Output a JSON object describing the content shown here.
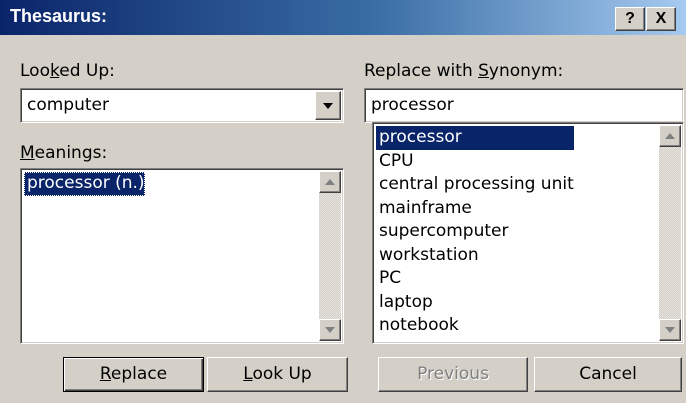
{
  "window": {
    "title": "Thesaurus:",
    "help_button": "?",
    "close_button": "X"
  },
  "looked_up": {
    "label_pre": "Loo",
    "label_key": "k",
    "label_post": "ed Up:",
    "value": "computer"
  },
  "meanings": {
    "label_key": "M",
    "label_post": "eanings:",
    "items": [
      "processor (n.)"
    ]
  },
  "replace_with": {
    "label_pre": "Replace with ",
    "label_key": "S",
    "label_post": "ynonym:",
    "value": "processor"
  },
  "synonyms": {
    "items": [
      "processor",
      "CPU",
      "central processing unit",
      "mainframe",
      "supercomputer",
      "workstation",
      "PC",
      "laptop",
      "notebook"
    ]
  },
  "buttons": {
    "replace_key": "R",
    "replace_post": "eplace",
    "lookup_key": "L",
    "lookup_post": "ook Up",
    "previous": "Previous",
    "cancel": "Cancel"
  },
  "colors": {
    "selection": "#0a246a",
    "face": "#d4d0c8"
  }
}
